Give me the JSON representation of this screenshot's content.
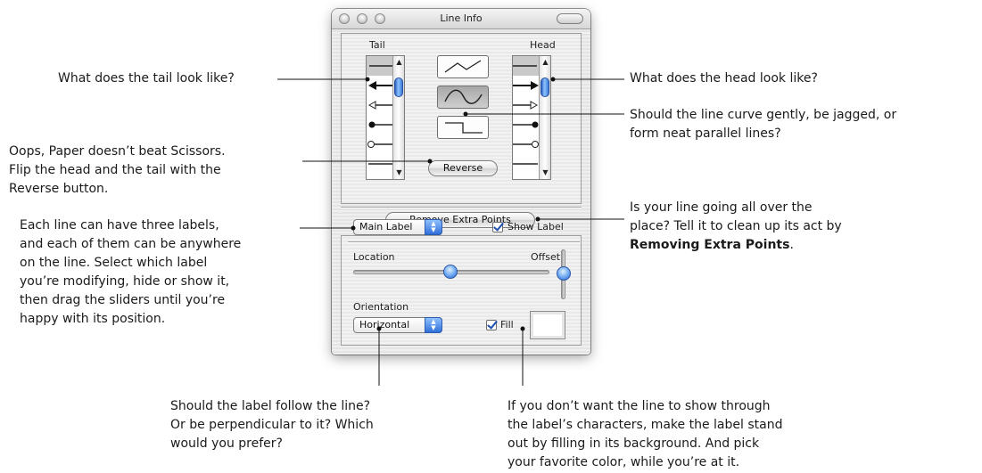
{
  "window": {
    "title": "Line Info",
    "tail_label": "Tail",
    "head_label": "Head",
    "reverse_button": "Reverse",
    "remove_points_button": "Remove Extra Points",
    "label_popup_value": "Main Label",
    "show_label_text": "Show Label",
    "show_label_checked": true,
    "location_label": "Location",
    "offset_label": "Offset",
    "orientation_label": "Orientation",
    "orientation_popup_value": "Horizontal",
    "fill_text": "Fill",
    "fill_checked": true,
    "fill_color": "#ffffff",
    "line_styles": [
      "straight",
      "curved",
      "orthogonal"
    ],
    "selected_line_style": "curved"
  },
  "annotations": {
    "tail": "What does the tail look like?",
    "head": "What does the head look like?",
    "curve": "Should the line curve gently, be jagged, or\nform neat parallel lines?",
    "reverse": "Oops, Paper doesn’t beat Scissors.\nFlip the head and the tail with the\nReverse button.",
    "remove_pre": "Is your line going all over the\nplace? Tell it to clean up its act by\n",
    "remove_bold": "Removing Extra Points",
    "remove_post": ".",
    "labels": "Each line can have three labels,\nand each of them can be anywhere\non the line. Select which label\nyou’re modifying, hide or show it,\nthen drag the sliders until you’re\nhappy with its position.",
    "orientation": "Should the label follow the line?\nOr be perpendicular to it? Which\nwould you prefer?",
    "fill": "If you don’t want the line to show through\nthe label’s characters, make the label stand\nout by filling in its background. And pick\nyour favorite color, while you’re at it."
  }
}
